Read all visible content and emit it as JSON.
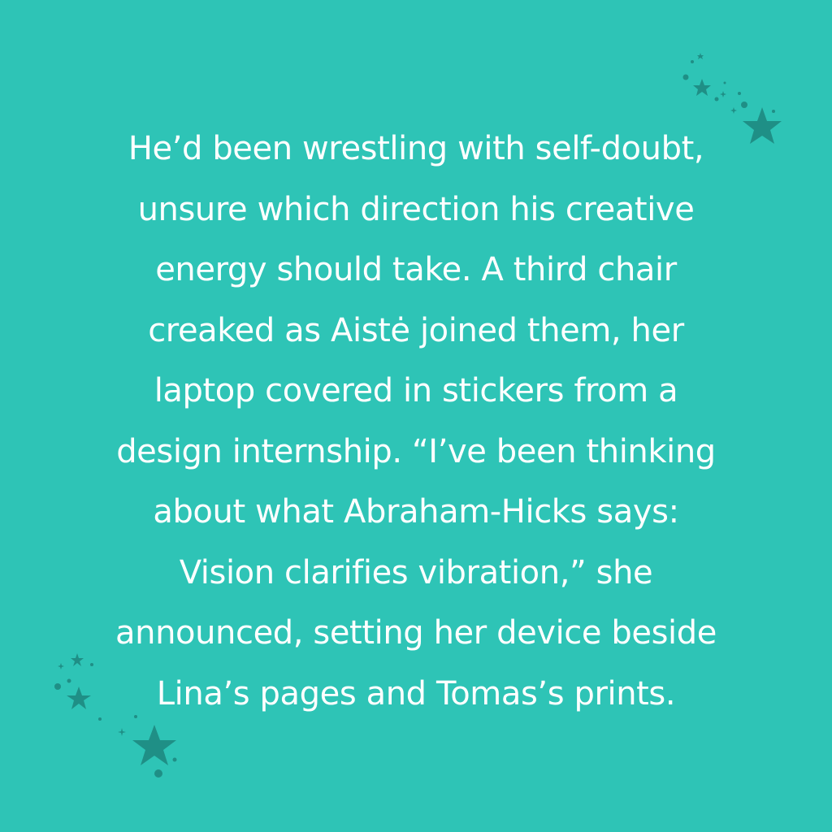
{
  "quote": {
    "lines": [
      "He’d been wrestling with self-doubt,",
      "unsure which direction his creative",
      "energy should take. A third chair",
      "creaked as Aistė joined them, her",
      "laptop covered in stickers from a",
      "design internship. “I’ve been thinking",
      "about what Abraham-Hicks says:",
      "Vision clarifies vibration,” she",
      "announced, setting her device beside",
      "Lina’s pages and Tomas’s prints."
    ]
  },
  "colors": {
    "background": "#2ec4b6",
    "text": "#ffffff",
    "decoration": "#1f8f86"
  },
  "decorations": {
    "top_right": "star-cluster-icon",
    "bottom_left": "star-cluster-icon"
  }
}
